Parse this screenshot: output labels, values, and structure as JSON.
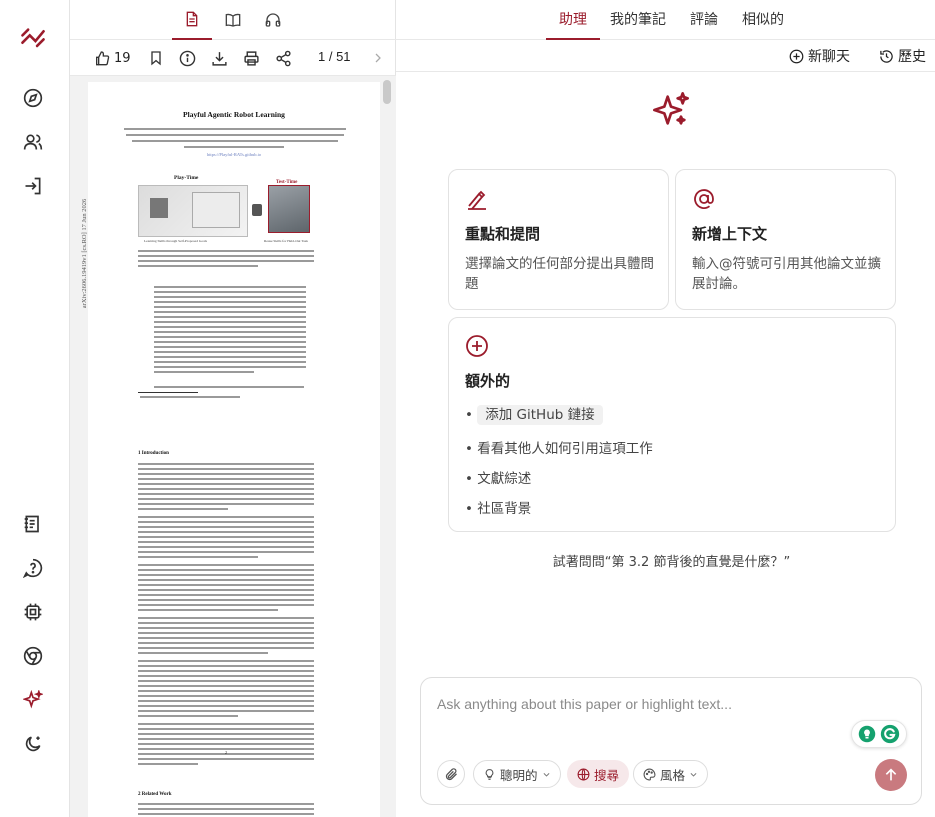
{
  "colors": {
    "accent": "#9b1c2c",
    "send_disabled": "#c97a7f",
    "grammarly": "#15a16e"
  },
  "rail": {
    "logo": "app-logo-icon",
    "top_icons": [
      "compass-icon",
      "users-icon",
      "sign-in-icon"
    ],
    "bottom_icons": [
      "notes-icon",
      "help-circle-icon",
      "chip-icon",
      "chrome-icon",
      "sparkle-rail-icon",
      "moon-icon"
    ]
  },
  "pdf": {
    "tabs": [
      "document-icon",
      "book-icon",
      "headphones-icon"
    ],
    "toolbar": {
      "likes": "19",
      "page": "1 / 51"
    },
    "paper": {
      "title": "Playful Agentic Robot Learning",
      "arxiv": "arXiv:2606.19419v1  [cs.RO]  17 Jun 2026",
      "url": "https://Playful-RATs.github.io",
      "play_time": "Play-Time",
      "test_time": "Test-Time",
      "fig_left": "Learning Skills through Self-Proposed Goals",
      "fig_right": "Reuse Skills for Held-Out Task",
      "intro": "1  Introduction",
      "related": "2  Related Work",
      "page_footer": "2"
    }
  },
  "right": {
    "tabs": [
      "助理",
      "我的筆記",
      "評論",
      "相似的"
    ],
    "toolbar": {
      "new_chat": "新聊天",
      "history": "歷史"
    },
    "cards": [
      {
        "title": "重點和提問",
        "desc": "選擇論文的任何部分提出具體問題",
        "icon": "highlight-pen-icon"
      },
      {
        "title": "新增上下文",
        "desc": "輸入@符號可引用其他論文並擴展討論。",
        "icon": "at-sign-icon"
      }
    ],
    "extra": {
      "title": "額外的",
      "icon": "plus-circle-icon",
      "items": [
        "添加 GitHub 鏈接",
        "看看其他人如何引用這項工作",
        "文獻綜述",
        "社區背景"
      ]
    },
    "suggestion": "試著問問“第 3.2 節背後的直覺是什麼？”",
    "chat": {
      "placeholder": "Ask anything about this paper or highlight text...",
      "mode": "聰明的",
      "search": "搜尋",
      "style": "風格"
    }
  }
}
